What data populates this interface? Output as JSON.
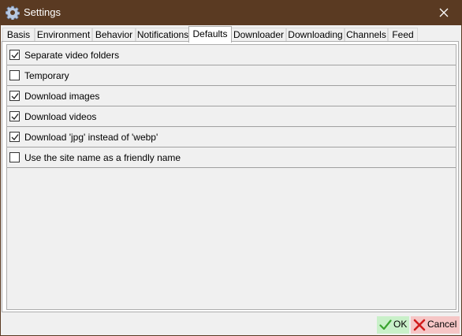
{
  "window": {
    "title": "Settings",
    "app_icon": "gear-icon",
    "close_icon": "close-icon"
  },
  "tabs": [
    {
      "label": "Basis"
    },
    {
      "label": "Environment"
    },
    {
      "label": "Behavior"
    },
    {
      "label": "Notifications"
    },
    {
      "label": "Defaults",
      "selected": true
    },
    {
      "label": "Downloader"
    },
    {
      "label": "Downloading"
    },
    {
      "label": "Channels"
    },
    {
      "label": "Feed"
    }
  ],
  "options": [
    {
      "label": "Separate video folders",
      "checked": true
    },
    {
      "label": "Temporary",
      "checked": false
    },
    {
      "label": "Download images",
      "checked": true
    },
    {
      "label": "Download videos",
      "checked": true
    },
    {
      "label": "Download 'jpg' instead of 'webp'",
      "checked": true
    },
    {
      "label": "Use the site name as a friendly name",
      "checked": false
    }
  ],
  "buttons": {
    "ok": {
      "label": "OK",
      "icon": "check-icon",
      "color": "#c9f0c9"
    },
    "cancel": {
      "label": "Cancel",
      "icon": "cross-icon",
      "color": "#f6c6c6"
    }
  },
  "colors": {
    "titlebar": "#5a3a22",
    "background": "#f0f0f0"
  }
}
